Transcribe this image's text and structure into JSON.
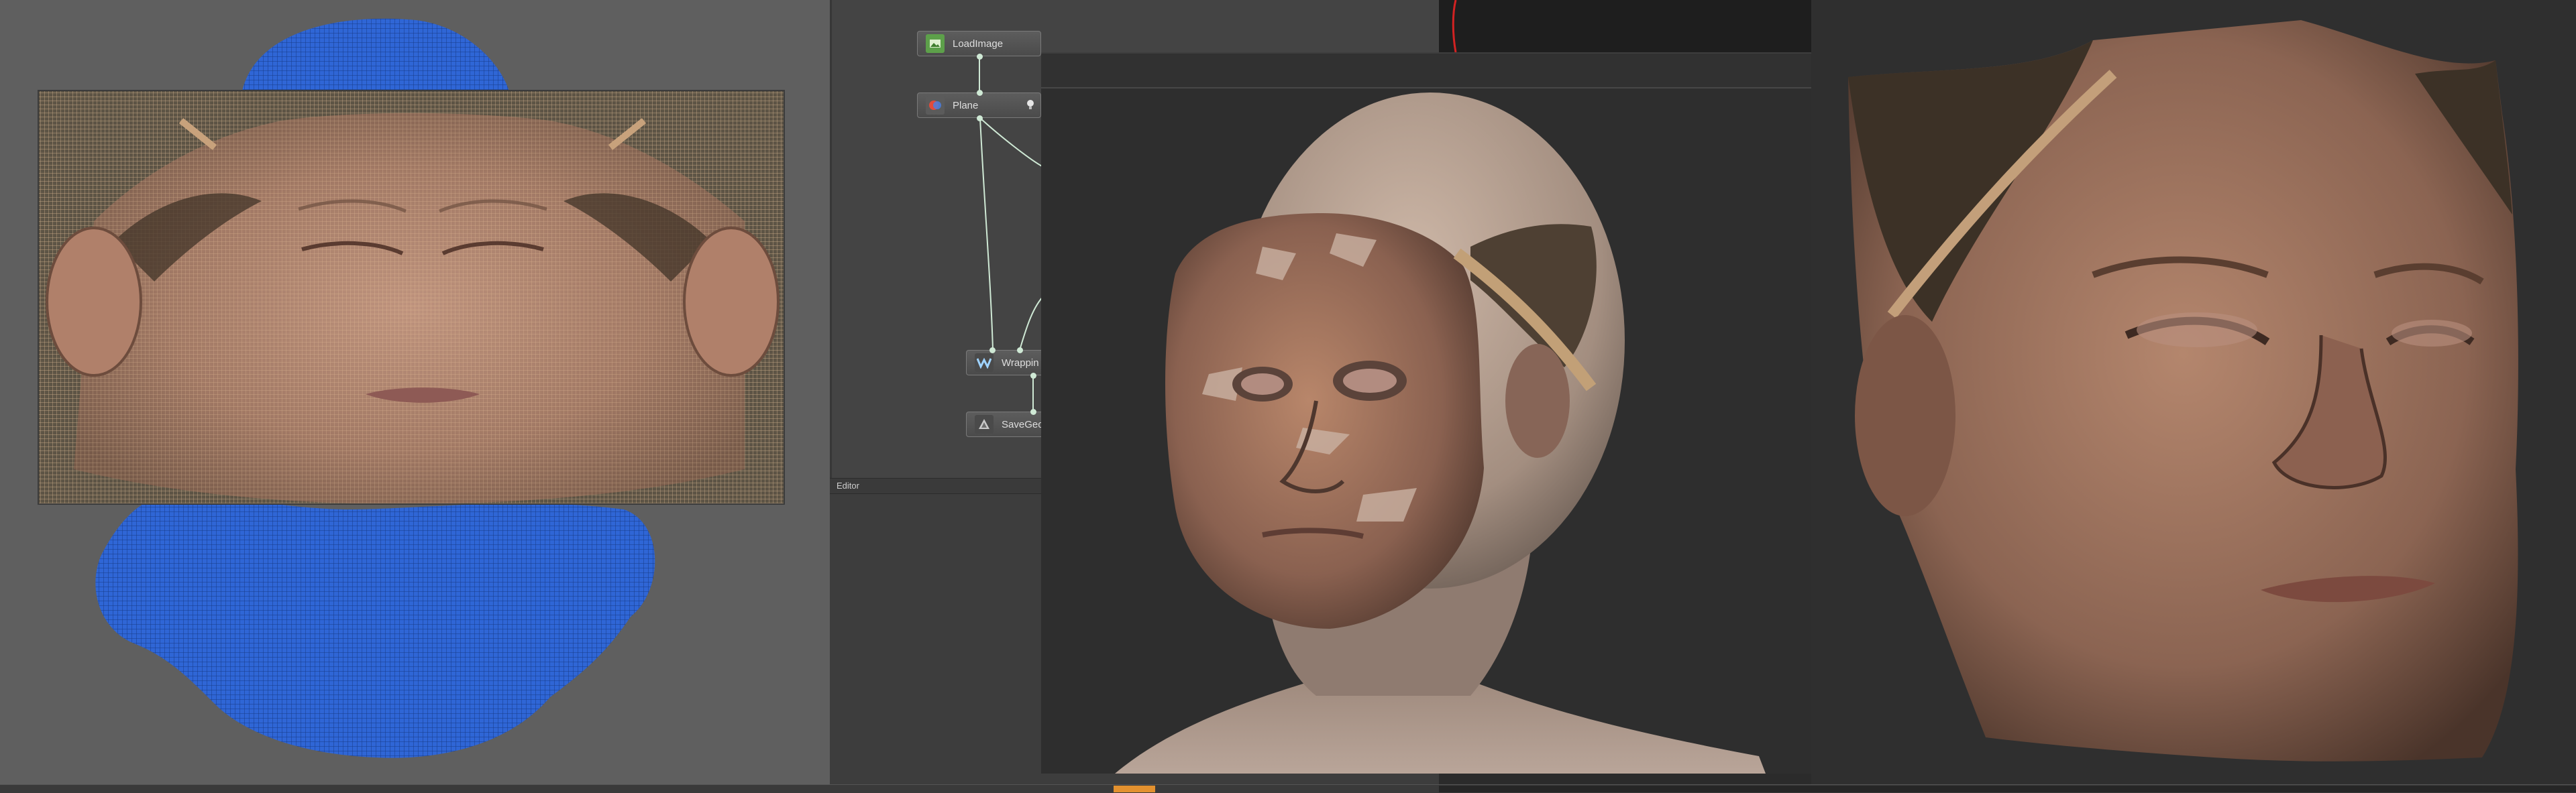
{
  "node_editor": {
    "nodes": [
      {
        "id": "loadimage",
        "label": "LoadImage",
        "icon": "image-icon"
      },
      {
        "id": "plane",
        "label": "Plane",
        "icon": "plane-icon"
      },
      {
        "id": "wrapping",
        "label": "Wrappin",
        "icon": "wrap-w-icon"
      },
      {
        "id": "savegeom",
        "label": "SaveGeo",
        "icon": "save-geometry-icon"
      }
    ],
    "editor_tab_label": "Editor"
  },
  "colors": {
    "wireframe_blue": "#2f66d6",
    "node_link": "#cfe9d5",
    "accent_orange": "#e3912f",
    "viewport_gray": "#5f5f5f"
  }
}
